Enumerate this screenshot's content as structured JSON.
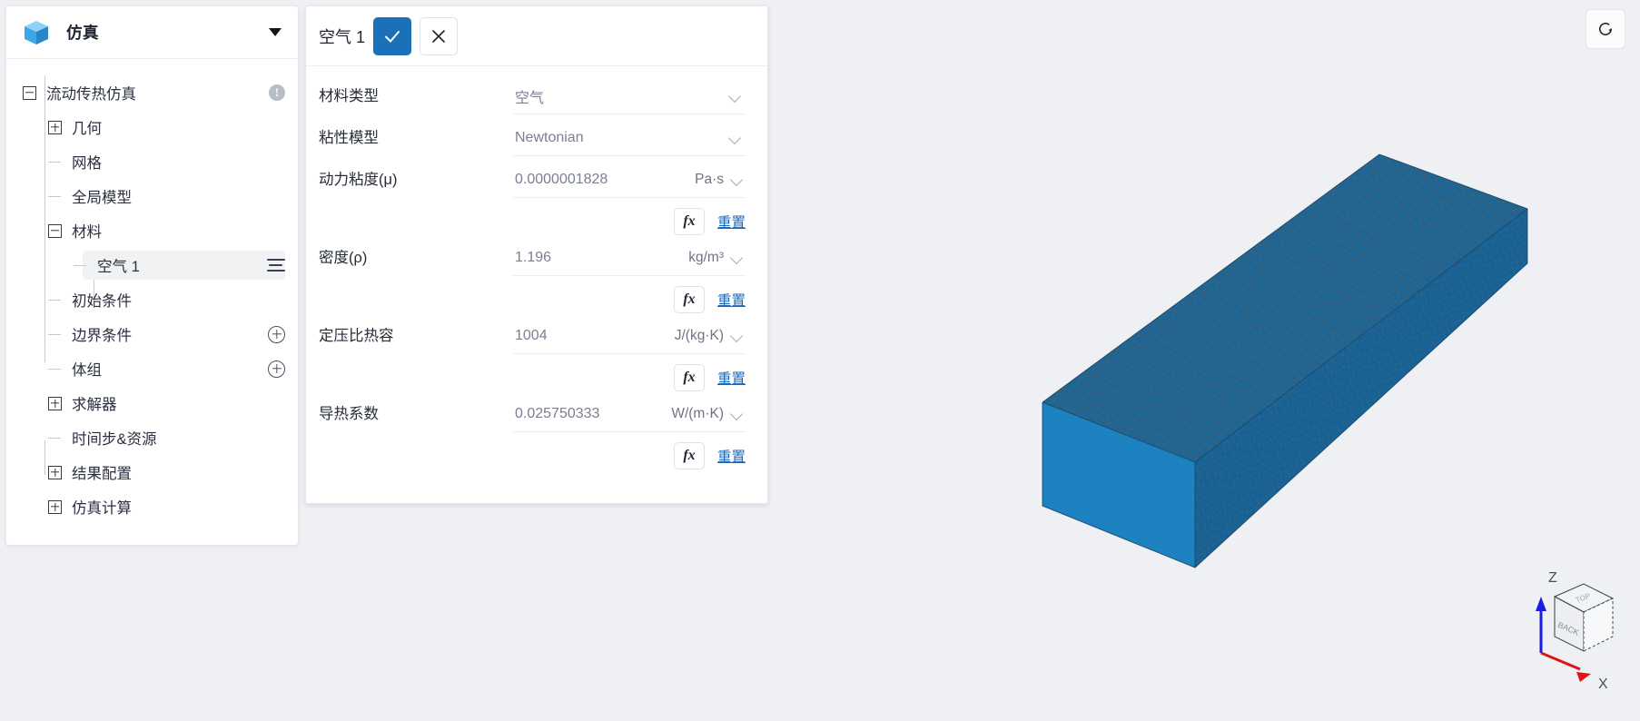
{
  "sidebar": {
    "title": "仿真",
    "logo_icon": "blue-cube-icon",
    "caret_icon": "caret-down-icon",
    "tree": [
      {
        "label": "流动传热仿真",
        "icon": "minus-box-icon",
        "badge": "!",
        "depth": 0,
        "type": "expanded"
      },
      {
        "label": "几何",
        "icon": "plus-box-icon",
        "depth": 1,
        "type": "collapsed"
      },
      {
        "label": "网格",
        "icon": "tree-leaf-icon",
        "depth": 1,
        "type": "leaf"
      },
      {
        "label": "全局模型",
        "icon": "tree-leaf-icon",
        "depth": 1,
        "type": "leaf"
      },
      {
        "label": "材料",
        "icon": "minus-box-icon",
        "depth": 1,
        "type": "expanded"
      },
      {
        "label": "空气 1",
        "icon": "list-menu-icon",
        "depth": 2,
        "type": "leaf",
        "selected": true
      },
      {
        "label": "初始条件",
        "icon": "tree-leaf-icon",
        "depth": 1,
        "type": "leaf"
      },
      {
        "label": "边界条件",
        "icon": "tree-leaf-icon",
        "depth": 1,
        "type": "leaf",
        "action": "plus-circle-icon"
      },
      {
        "label": "体组",
        "icon": "tree-leaf-icon",
        "depth": 1,
        "type": "leaf",
        "action": "plus-circle-icon"
      },
      {
        "label": "求解器",
        "icon": "plus-box-icon",
        "depth": 1,
        "type": "collapsed"
      },
      {
        "label": "时间步&资源",
        "icon": "tree-leaf-icon",
        "depth": 1,
        "type": "leaf"
      },
      {
        "label": "结果配置",
        "icon": "plus-box-icon",
        "depth": 1,
        "type": "collapsed"
      },
      {
        "label": "仿真计算",
        "icon": "plus-box-icon",
        "depth": 1,
        "type": "collapsed"
      }
    ]
  },
  "properties": {
    "title": "空气 1",
    "confirm_icon": "check-icon",
    "cancel_icon": "close-icon",
    "fx_label": "fx",
    "reset_label": "重置",
    "rows": [
      {
        "label": "材料类型",
        "value": "空气",
        "unit": "",
        "kind": "select",
        "has_fx": false
      },
      {
        "label": "粘性模型",
        "value": "Newtonian",
        "unit": "",
        "kind": "select",
        "has_fx": false
      },
      {
        "label": "动力粘度(μ)",
        "value": "0.0000001828",
        "unit": "Pa·s",
        "kind": "value-unit",
        "has_fx": true
      },
      {
        "label": "密度(ρ)",
        "value": "1.196",
        "unit": "kg/m³",
        "kind": "value-unit",
        "has_fx": true
      },
      {
        "label": "定压比热容",
        "value": "1004",
        "unit": "J/(kg·K)",
        "kind": "value-unit",
        "has_fx": true
      },
      {
        "label": "导热系数",
        "value": "0.025750333",
        "unit": "W/(m·K)",
        "kind": "value-unit",
        "has_fx": true
      }
    ]
  },
  "viewport": {
    "reset_view_icon": "reset-rotate-icon",
    "nav_cube": {
      "face_top_label": "TOP",
      "face_front_label": "BACK",
      "axis_z_label": "Z",
      "axis_x_label": "X",
      "axis_z_color": "#1a1ae0",
      "axis_x_color": "#e01414"
    },
    "mesh": {
      "top_face_color": "#1c6594",
      "side_face_color": "#1a7cb8",
      "end_face_color": "#1b82c2",
      "wire_color": "#4c6376",
      "background_color": "#eef0f4"
    }
  }
}
